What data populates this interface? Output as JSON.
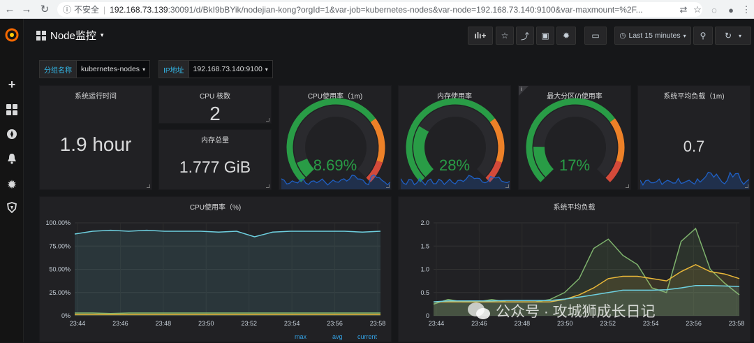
{
  "browser": {
    "insecure_label": "不安全",
    "host": "192.168.73.139",
    "url_rest": ":30091/d/BkI9bBYik/nodejian-kong?orgId=1&var-job=kubernetes-nodes&var-node=192.168.73.140:9100&var-maxmount=%2F..."
  },
  "dashboard": {
    "title": "Node监控",
    "time_range": "Last 15 minutes"
  },
  "variables": [
    {
      "label": "分组名称",
      "value": "kubernetes-nodes"
    },
    {
      "label": "IP地址",
      "value": "192.168.73.140:9100"
    }
  ],
  "panels": {
    "uptime": {
      "title": "系统运行时间",
      "value": "1.9 hour"
    },
    "cpu_cores": {
      "title": "CPU 核数",
      "value": "2"
    },
    "mem_total": {
      "title": "内存总量",
      "value": "1.777 GiB"
    },
    "cpu_usage": {
      "title": "CPU使用率（1m)",
      "value": "8.69%",
      "level": 8.69
    },
    "mem_usage": {
      "title": "内存使用率",
      "value": "28%",
      "level": 28
    },
    "disk_usage": {
      "title": "最大分区(/)使用率",
      "value": "17%",
      "level": 17
    },
    "load": {
      "title": "系统平均负载（1m)",
      "value": "0.7"
    }
  },
  "cpu_chart": {
    "title": "CPU使用率（%)",
    "legend": [
      "max",
      "avg",
      "current"
    ]
  },
  "load_chart": {
    "title": "系统平均负载"
  },
  "chart_data": [
    {
      "type": "line",
      "title": "CPU使用率（%)",
      "x": [
        "23:44",
        "23:46",
        "23:48",
        "23:50",
        "23:52",
        "23:54",
        "23:56",
        "23:58"
      ],
      "ylim": [
        0,
        100
      ],
      "yticks": [
        "0%",
        "25.00%",
        "50.00%",
        "75.00%",
        "100.00%"
      ],
      "series": [
        {
          "color": "#6ed0e0",
          "values": [
            88,
            91,
            92,
            91,
            92,
            91,
            91,
            91,
            90,
            91,
            85,
            90,
            91,
            91,
            91,
            91,
            90,
            91
          ]
        },
        {
          "color": "#7eb26d",
          "values": [
            3,
            3,
            2.5,
            3,
            3,
            3,
            3,
            3,
            3,
            3,
            3,
            3,
            3,
            3,
            3,
            3,
            3,
            3
          ]
        },
        {
          "color": "#eab839",
          "values": [
            1.5,
            1.5,
            1.5,
            1.5,
            1.5,
            1.5,
            1.5,
            1.5,
            1.5,
            1.5,
            1.5,
            1.5,
            1.5,
            1.5,
            1.5,
            1.5,
            1.5,
            1.5
          ]
        }
      ]
    },
    {
      "type": "line",
      "title": "系统平均负载",
      "x": [
        "23:44",
        "23:46",
        "23:48",
        "23:50",
        "23:52",
        "23:54",
        "23:56",
        "23:58"
      ],
      "ylim": [
        0,
        2
      ],
      "yticks": [
        "0",
        "0.5",
        "1.0",
        "1.5",
        "2.0"
      ],
      "series": [
        {
          "color": "#7eb26d",
          "values": [
            0.25,
            0.35,
            0.3,
            0.3,
            0.35,
            0.3,
            0.3,
            0.3,
            0.35,
            0.5,
            0.8,
            1.45,
            1.65,
            1.3,
            1.1,
            0.6,
            0.5,
            1.6,
            1.88,
            1.0,
            0.7,
            0.45
          ]
        },
        {
          "color": "#eab839",
          "values": [
            0.3,
            0.3,
            0.3,
            0.3,
            0.3,
            0.3,
            0.3,
            0.3,
            0.3,
            0.35,
            0.45,
            0.6,
            0.8,
            0.85,
            0.85,
            0.8,
            0.75,
            0.95,
            1.1,
            0.95,
            0.9,
            0.8
          ]
        },
        {
          "color": "#6ed0e0",
          "values": [
            0.3,
            0.32,
            0.32,
            0.32,
            0.32,
            0.33,
            0.33,
            0.33,
            0.33,
            0.36,
            0.4,
            0.45,
            0.5,
            0.55,
            0.55,
            0.55,
            0.56,
            0.6,
            0.65,
            0.65,
            0.64,
            0.63
          ]
        }
      ]
    }
  ],
  "watermark": "公众号 · 攻城狮成长日记"
}
